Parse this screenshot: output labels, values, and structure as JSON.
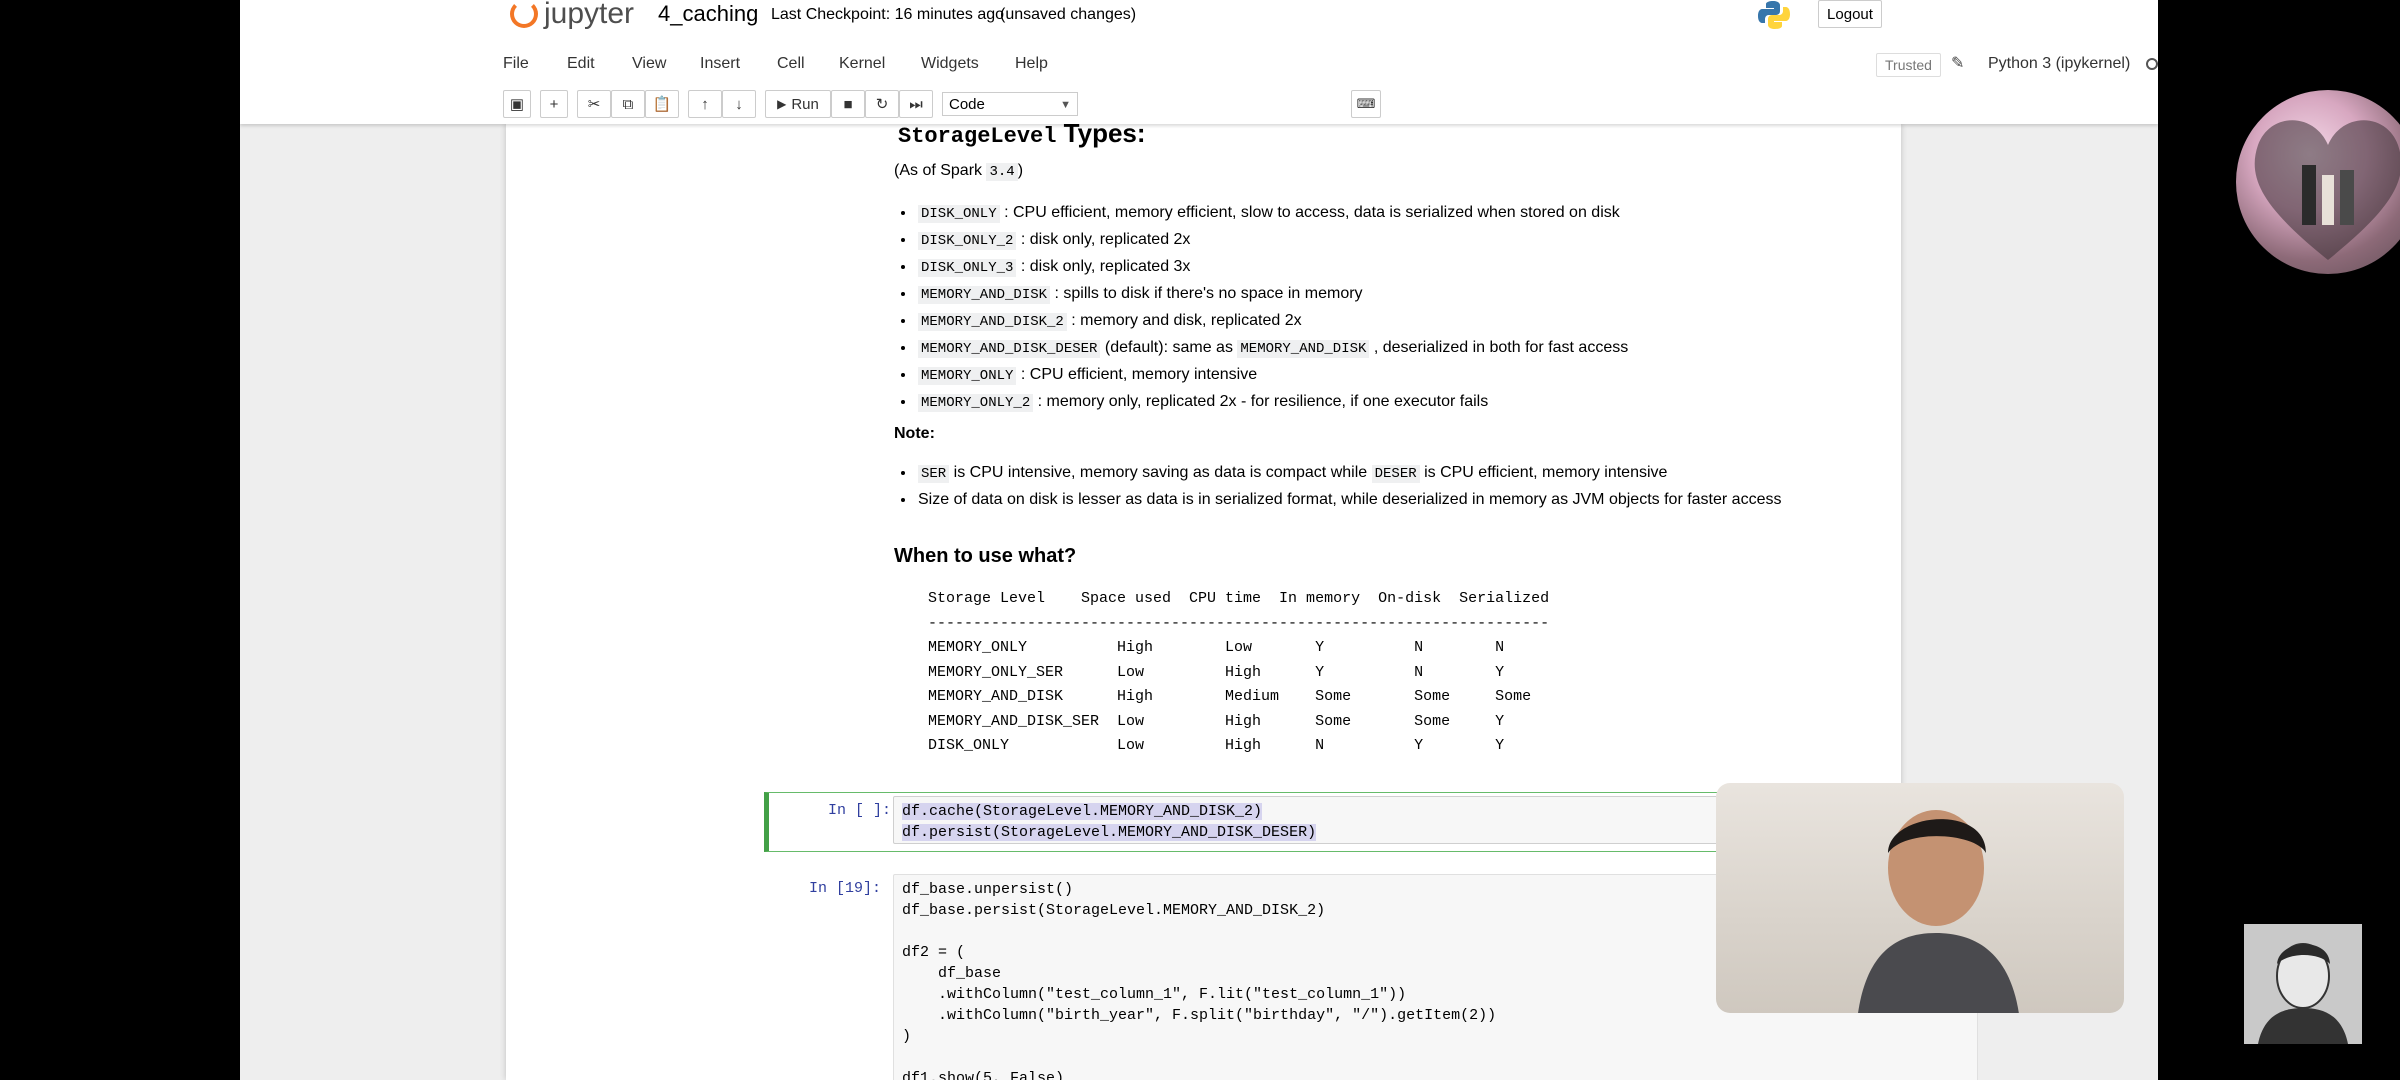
{
  "app": {
    "logo_text": "jupyter",
    "notebook_name": "4_caching",
    "checkpoint": "Last Checkpoint: 16 minutes ago",
    "unsaved": "(unsaved changes)",
    "logout_label": "Logout"
  },
  "menu": {
    "items": [
      "File",
      "Edit",
      "View",
      "Insert",
      "Cell",
      "Kernel",
      "Widgets",
      "Help"
    ],
    "trusted": "Trusted",
    "kernel": "Python 3 (ipykernel)"
  },
  "toolbar": {
    "run_label": "Run",
    "cell_type": "Code"
  },
  "markdown": {
    "heading_code": "StorageLevel",
    "heading_rest": " Types:",
    "as_of_prefix": "(As of Spark ",
    "as_of_version": "3.4",
    "as_of_suffix": ")",
    "levels": [
      {
        "code": "DISK_ONLY",
        "desc": " : CPU efficient, memory efficient, slow to access, data is serialized when stored on disk"
      },
      {
        "code": "DISK_ONLY_2",
        "desc": " : disk only, replicated 2x"
      },
      {
        "code": "DISK_ONLY_3",
        "desc": " : disk only, replicated 3x"
      },
      {
        "code": "MEMORY_AND_DISK",
        "desc": " : spills to disk if there's no space in memory"
      },
      {
        "code": "MEMORY_AND_DISK_2",
        "desc": " : memory and disk, replicated 2x"
      },
      {
        "code": "MEMORY_AND_DISK_DESER",
        "desc": " (default): same as ",
        "code2": "MEMORY_AND_DISK",
        "desc2": " , deserialized in both for fast access"
      },
      {
        "code": "MEMORY_ONLY",
        "desc": " : CPU efficient, memory intensive"
      },
      {
        "code": "MEMORY_ONLY_2",
        "desc": " : memory only, replicated 2x - for resilience, if one executor fails"
      }
    ],
    "note_label": "Note",
    "notes": [
      {
        "code": "SER",
        "desc": " is CPU intensive, memory saving as data is compact while ",
        "code2": "DESER",
        "desc2": " is CPU efficient, memory intensive"
      },
      {
        "desc": "Size of data on disk is lesser as data is in serialized format, while deserialized in memory as JVM objects for faster access"
      }
    ],
    "when_heading": "When to use what?",
    "table_text": "Storage Level    Space used  CPU time  In memory  On-disk  Serialized\n---------------------------------------------------------------------\nMEMORY_ONLY          High        Low       Y          N        N\nMEMORY_ONLY_SER      Low         High      Y          N        Y\nMEMORY_AND_DISK      High        Medium    Some       Some     Some\nMEMORY_AND_DISK_SER  Low         High      Some       Some     Y\nDISK_ONLY            Low         High      N          Y        Y"
  },
  "cells": [
    {
      "prompt": "In [ ]:",
      "lines": [
        "df.cache(StorageLevel.MEMORY_AND_DISK_2)",
        "df.persist(StorageLevel.MEMORY_AND_DISK_DESER)"
      ]
    },
    {
      "prompt": "In [19]:",
      "lines": [
        "df_base.unpersist()",
        "df_base.persist(StorageLevel.MEMORY_AND_DISK_2)",
        "",
        "df2 = (",
        "    df_base",
        "    .withColumn(\"test_column_1\", F.lit(\"test_column_1\"))",
        "    .withColumn(\"birth_year\", F.split(\"birthday\", \"/\").getItem(2))",
        ")",
        "",
        "df1.show(5, False)"
      ]
    }
  ],
  "icons": [
    "python-logo-icon",
    "pencil-icon",
    "kernel-idle-icon",
    "save-icon",
    "plus-icon",
    "cut-icon",
    "copy-icon",
    "paste-icon",
    "arrow-up-icon",
    "arrow-down-icon",
    "play-icon",
    "stop-icon",
    "restart-icon",
    "fast-forward-icon",
    "keyboard-icon"
  ]
}
